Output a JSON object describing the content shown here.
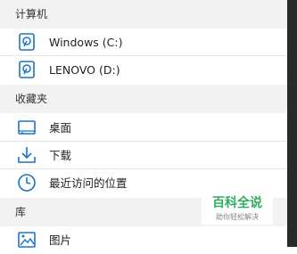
{
  "sections": {
    "computer": {
      "header": "计算机",
      "items": [
        {
          "label": "Windows (C:)"
        },
        {
          "label": "LENOVO (D:)"
        }
      ]
    },
    "favorites": {
      "header": "收藏夹",
      "items": [
        {
          "label": "桌面"
        },
        {
          "label": "下载"
        },
        {
          "label": "最近访问的位置"
        }
      ]
    },
    "library": {
      "header": "库",
      "items": [
        {
          "label": "图片"
        }
      ]
    }
  },
  "watermark": {
    "title": "百科全说",
    "subtitle": "助你轻松解决"
  },
  "colors": {
    "accent": "#1a73c8",
    "header_bg": "#f2f2f2",
    "watermark": "#2fae5d",
    "scrollbar": "#2a2a2a"
  },
  "icons": [
    "drive-icon",
    "desktop-icon",
    "download-icon",
    "recent-places-icon",
    "pictures-icon"
  ]
}
